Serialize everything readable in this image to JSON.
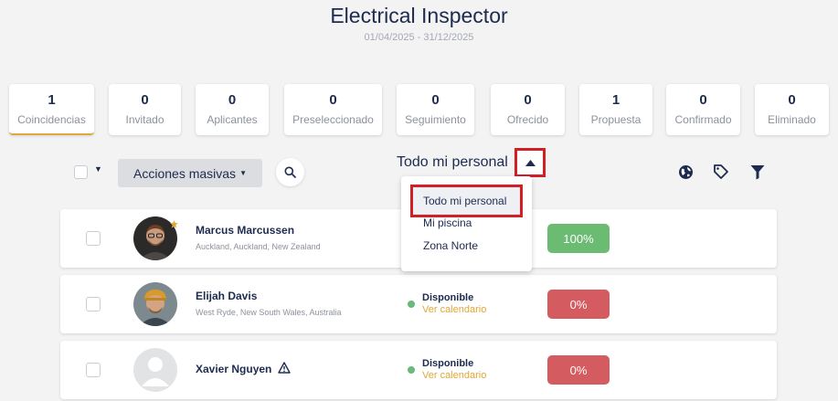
{
  "header": {
    "title": "Electrical Inspector",
    "date_range": "01/04/2025 - 31/12/2025"
  },
  "stages": [
    {
      "count": "1",
      "label": "Coincidencias",
      "active": true
    },
    {
      "count": "0",
      "label": "Invitado"
    },
    {
      "count": "0",
      "label": "Aplicantes"
    },
    {
      "count": "0",
      "label": "Preseleccionado"
    },
    {
      "count": "0",
      "label": "Seguimiento"
    },
    {
      "count": "0",
      "label": "Ofrecido"
    },
    {
      "count": "1",
      "label": "Propuesta"
    },
    {
      "count": "0",
      "label": "Confirmado"
    },
    {
      "count": "0",
      "label": "Eliminado"
    }
  ],
  "toolbar": {
    "bulk_label": "Acciones masivas",
    "filter_label": "Todo mi personal",
    "icons": [
      "globe-icon",
      "tag-icon",
      "filter-icon"
    ]
  },
  "dropdown": {
    "options": [
      "Todo mi personal",
      "Mi piscina",
      "Zona Norte"
    ],
    "selected": "Todo mi personal"
  },
  "candidates": [
    {
      "name": "Marcus Marcussen",
      "location": "Auckland, Auckland, New Zealand",
      "status": "",
      "calendar": "",
      "score": "100%",
      "favorite": true
    },
    {
      "name": "Elijah Davis",
      "location": "West Ryde, New South Wales, Australia",
      "status": "Disponible",
      "calendar": "Ver calendario",
      "score": "0%"
    },
    {
      "name": "Xavier Nguyen",
      "location": "",
      "status": "Disponible",
      "calendar": "Ver calendario",
      "score": "0%",
      "warning": true
    }
  ],
  "colors": {
    "accent": "#e2a73a",
    "navy": "#1d2b4f",
    "score_good": "#6bbb73",
    "score_bad": "#d45b5f",
    "available": "#6bb97a",
    "highlight": "#d21f26"
  }
}
